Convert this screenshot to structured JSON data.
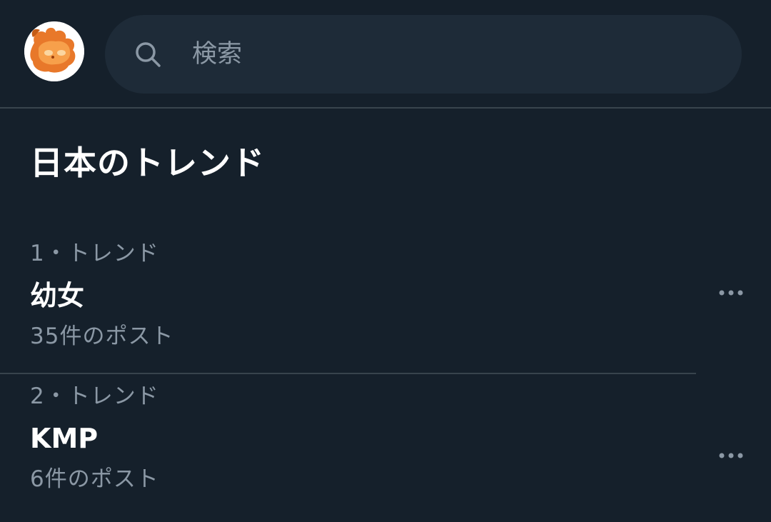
{
  "search": {
    "placeholder": "検索",
    "value": ""
  },
  "icons": {
    "avatar": "avatar-orange-creature",
    "search": "search-icon",
    "more": "more-horizontal-icon"
  },
  "colors": {
    "background": "#15202b",
    "search_background": "#1e2b38",
    "divider": "#38444d",
    "secondary_text": "#8b98a5",
    "primary_text": "#ffffff"
  },
  "section": {
    "title": "日本のトレンド"
  },
  "trends": [
    {
      "meta": "1・トレンド",
      "name": "幼女",
      "count": "35件のポスト"
    },
    {
      "meta": "2・トレンド",
      "name": "KMP",
      "count": "6件のポスト"
    }
  ]
}
